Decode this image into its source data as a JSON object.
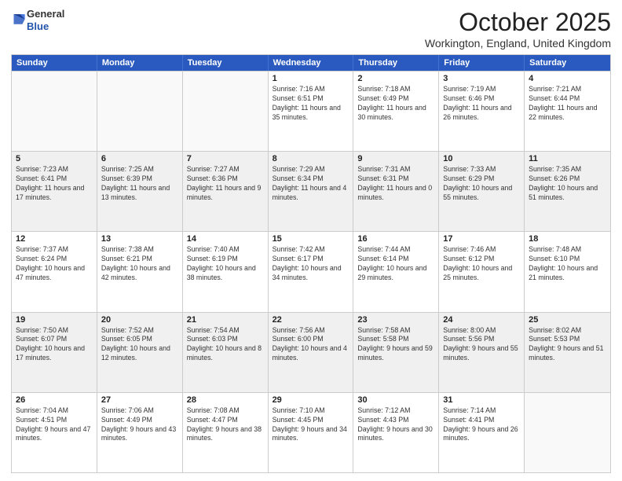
{
  "logo": {
    "general": "General",
    "blue": "Blue"
  },
  "title": "October 2025",
  "location": "Workington, England, United Kingdom",
  "days_of_week": [
    "Sunday",
    "Monday",
    "Tuesday",
    "Wednesday",
    "Thursday",
    "Friday",
    "Saturday"
  ],
  "weeks": [
    [
      {
        "day": "",
        "info": ""
      },
      {
        "day": "",
        "info": ""
      },
      {
        "day": "",
        "info": ""
      },
      {
        "day": "1",
        "info": "Sunrise: 7:16 AM\nSunset: 6:51 PM\nDaylight: 11 hours and 35 minutes."
      },
      {
        "day": "2",
        "info": "Sunrise: 7:18 AM\nSunset: 6:49 PM\nDaylight: 11 hours and 30 minutes."
      },
      {
        "day": "3",
        "info": "Sunrise: 7:19 AM\nSunset: 6:46 PM\nDaylight: 11 hours and 26 minutes."
      },
      {
        "day": "4",
        "info": "Sunrise: 7:21 AM\nSunset: 6:44 PM\nDaylight: 11 hours and 22 minutes."
      }
    ],
    [
      {
        "day": "5",
        "info": "Sunrise: 7:23 AM\nSunset: 6:41 PM\nDaylight: 11 hours and 17 minutes."
      },
      {
        "day": "6",
        "info": "Sunrise: 7:25 AM\nSunset: 6:39 PM\nDaylight: 11 hours and 13 minutes."
      },
      {
        "day": "7",
        "info": "Sunrise: 7:27 AM\nSunset: 6:36 PM\nDaylight: 11 hours and 9 minutes."
      },
      {
        "day": "8",
        "info": "Sunrise: 7:29 AM\nSunset: 6:34 PM\nDaylight: 11 hours and 4 minutes."
      },
      {
        "day": "9",
        "info": "Sunrise: 7:31 AM\nSunset: 6:31 PM\nDaylight: 11 hours and 0 minutes."
      },
      {
        "day": "10",
        "info": "Sunrise: 7:33 AM\nSunset: 6:29 PM\nDaylight: 10 hours and 55 minutes."
      },
      {
        "day": "11",
        "info": "Sunrise: 7:35 AM\nSunset: 6:26 PM\nDaylight: 10 hours and 51 minutes."
      }
    ],
    [
      {
        "day": "12",
        "info": "Sunrise: 7:37 AM\nSunset: 6:24 PM\nDaylight: 10 hours and 47 minutes."
      },
      {
        "day": "13",
        "info": "Sunrise: 7:38 AM\nSunset: 6:21 PM\nDaylight: 10 hours and 42 minutes."
      },
      {
        "day": "14",
        "info": "Sunrise: 7:40 AM\nSunset: 6:19 PM\nDaylight: 10 hours and 38 minutes."
      },
      {
        "day": "15",
        "info": "Sunrise: 7:42 AM\nSunset: 6:17 PM\nDaylight: 10 hours and 34 minutes."
      },
      {
        "day": "16",
        "info": "Sunrise: 7:44 AM\nSunset: 6:14 PM\nDaylight: 10 hours and 29 minutes."
      },
      {
        "day": "17",
        "info": "Sunrise: 7:46 AM\nSunset: 6:12 PM\nDaylight: 10 hours and 25 minutes."
      },
      {
        "day": "18",
        "info": "Sunrise: 7:48 AM\nSunset: 6:10 PM\nDaylight: 10 hours and 21 minutes."
      }
    ],
    [
      {
        "day": "19",
        "info": "Sunrise: 7:50 AM\nSunset: 6:07 PM\nDaylight: 10 hours and 17 minutes."
      },
      {
        "day": "20",
        "info": "Sunrise: 7:52 AM\nSunset: 6:05 PM\nDaylight: 10 hours and 12 minutes."
      },
      {
        "day": "21",
        "info": "Sunrise: 7:54 AM\nSunset: 6:03 PM\nDaylight: 10 hours and 8 minutes."
      },
      {
        "day": "22",
        "info": "Sunrise: 7:56 AM\nSunset: 6:00 PM\nDaylight: 10 hours and 4 minutes."
      },
      {
        "day": "23",
        "info": "Sunrise: 7:58 AM\nSunset: 5:58 PM\nDaylight: 9 hours and 59 minutes."
      },
      {
        "day": "24",
        "info": "Sunrise: 8:00 AM\nSunset: 5:56 PM\nDaylight: 9 hours and 55 minutes."
      },
      {
        "day": "25",
        "info": "Sunrise: 8:02 AM\nSunset: 5:53 PM\nDaylight: 9 hours and 51 minutes."
      }
    ],
    [
      {
        "day": "26",
        "info": "Sunrise: 7:04 AM\nSunset: 4:51 PM\nDaylight: 9 hours and 47 minutes."
      },
      {
        "day": "27",
        "info": "Sunrise: 7:06 AM\nSunset: 4:49 PM\nDaylight: 9 hours and 43 minutes."
      },
      {
        "day": "28",
        "info": "Sunrise: 7:08 AM\nSunset: 4:47 PM\nDaylight: 9 hours and 38 minutes."
      },
      {
        "day": "29",
        "info": "Sunrise: 7:10 AM\nSunset: 4:45 PM\nDaylight: 9 hours and 34 minutes."
      },
      {
        "day": "30",
        "info": "Sunrise: 7:12 AM\nSunset: 4:43 PM\nDaylight: 9 hours and 30 minutes."
      },
      {
        "day": "31",
        "info": "Sunrise: 7:14 AM\nSunset: 4:41 PM\nDaylight: 9 hours and 26 minutes."
      },
      {
        "day": "",
        "info": ""
      }
    ]
  ]
}
